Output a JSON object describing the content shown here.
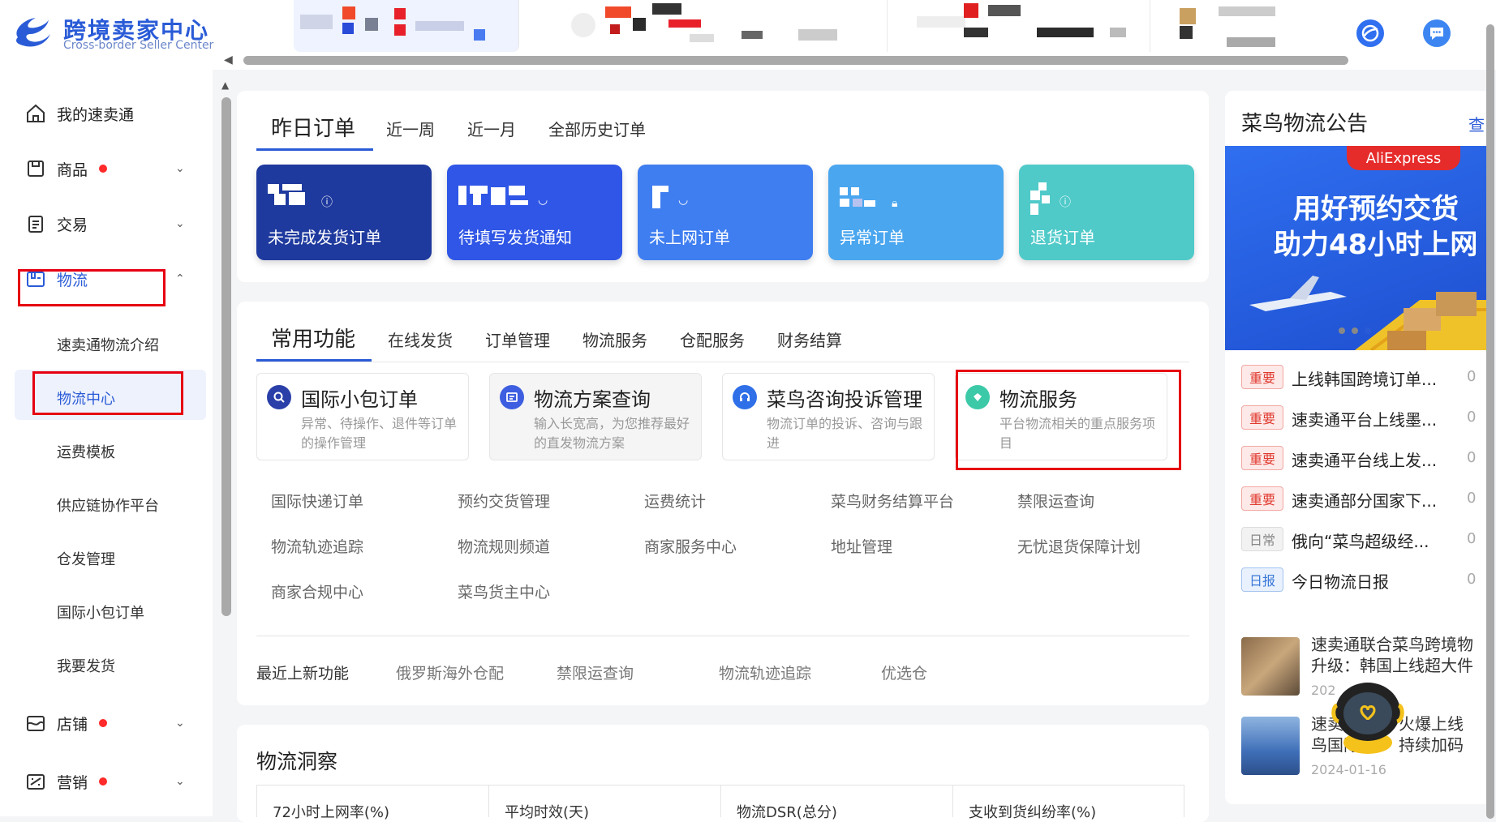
{
  "brand": {
    "title": "跨境卖家中心",
    "subtitle": "Cross-border Seller Center"
  },
  "sidebar": {
    "items": [
      {
        "label": "我的速卖通",
        "icon": "home-icon"
      },
      {
        "label": "商品",
        "icon": "product-icon",
        "dot": true
      },
      {
        "label": "交易",
        "icon": "trade-icon"
      },
      {
        "label": "物流",
        "icon": "logistics-icon"
      },
      {
        "label": "店铺",
        "icon": "store-icon",
        "dot": true
      },
      {
        "label": "营销",
        "icon": "marketing-icon",
        "dot": true
      }
    ],
    "logistics_sub": [
      "速卖通物流介绍",
      "物流中心",
      "运费模板",
      "供应链协作平台",
      "仓发管理",
      "国际小包订单",
      "我要发货"
    ]
  },
  "orders": {
    "tabs": [
      "昨日订单",
      "近一周",
      "近一月",
      "全部历史订单"
    ],
    "tiles": [
      {
        "label": "未完成发货订单",
        "color": "#1f3a9e"
      },
      {
        "label": "待填写发货通知",
        "color": "#2f56e6"
      },
      {
        "label": "未上网订单",
        "color": "#3f7ef0"
      },
      {
        "label": "异常订单",
        "color": "#4aa6ef"
      },
      {
        "label": "退货订单",
        "color": "#4fcac9"
      }
    ]
  },
  "functions": {
    "tabs": [
      "常用功能",
      "在线发货",
      "订单管理",
      "物流服务",
      "仓配服务",
      "财务结算"
    ],
    "cards": [
      {
        "title": "国际小包订单",
        "desc": "异常、待操作、退件等订单的操作管理",
        "icon": "search-icon",
        "color": "#2a3fa8"
      },
      {
        "title": "物流方案查询",
        "desc": "输入长宽高，为您推荐最好的直发物流方案",
        "icon": "plan-icon",
        "color": "#3d5ee0"
      },
      {
        "title": "菜鸟咨询投诉管理",
        "desc": "物流订单的投诉、咨询与跟进",
        "icon": "headset-icon",
        "color": "#2f6fe8"
      },
      {
        "title": "物流服务",
        "desc": "平台物流相关的重点服务项目",
        "icon": "service-icon",
        "color": "#3cc9a8"
      }
    ],
    "links": [
      [
        "国际快递订单",
        "预约交货管理",
        "运费统计",
        "菜鸟财务结算平台",
        "禁限运查询"
      ],
      [
        "物流轨迹追踪",
        "物流规则频道",
        "商家服务中心",
        "地址管理",
        "无忧退货保障计划"
      ],
      [
        "商家合规中心",
        "菜鸟货主中心"
      ]
    ],
    "recent": {
      "label": "最近上新功能",
      "items": [
        "俄罗斯海外仓配",
        "禁限运查询",
        "物流轨迹追踪",
        "优选仓"
      ]
    }
  },
  "insight": {
    "title": "物流洞察",
    "metrics": [
      "72小时上网率(%)",
      "平均时效(天)",
      "物流DSR(总分)",
      "支收到货纠纷率(%)"
    ]
  },
  "notice": {
    "title": "菜鸟物流公告",
    "more": "查",
    "banner": {
      "brand": "AliExpress",
      "line1": "用好预约交货",
      "line2": "助力48小时上网"
    },
    "items": [
      {
        "badge": "重要",
        "type": "imp",
        "text": "上线韩国跨境订单...",
        "num": "0"
      },
      {
        "badge": "重要",
        "type": "imp",
        "text": "速卖通平台上线墨...",
        "num": "0"
      },
      {
        "badge": "重要",
        "type": "imp",
        "text": "速卖通平台线上发...",
        "num": "0"
      },
      {
        "badge": "重要",
        "type": "imp",
        "text": "速卖通部分国家下...",
        "num": "0"
      },
      {
        "badge": "日常",
        "type": "day",
        "text": "俄向“菜鸟超级经...",
        "num": "0"
      },
      {
        "badge": "日报",
        "type": "rep",
        "text": "今日物流日报",
        "num": "0"
      }
    ],
    "news": [
      {
        "line1": "速卖通联合菜鸟跨境物",
        "line2": "升级：韩国上线超大件",
        "date": "202"
      },
      {
        "line1": "速卖",
        "line2": "鸟国际",
        "line2b": "持续加码",
        "line1b": "火爆上线",
        "date": "2024-01-16"
      }
    ]
  }
}
